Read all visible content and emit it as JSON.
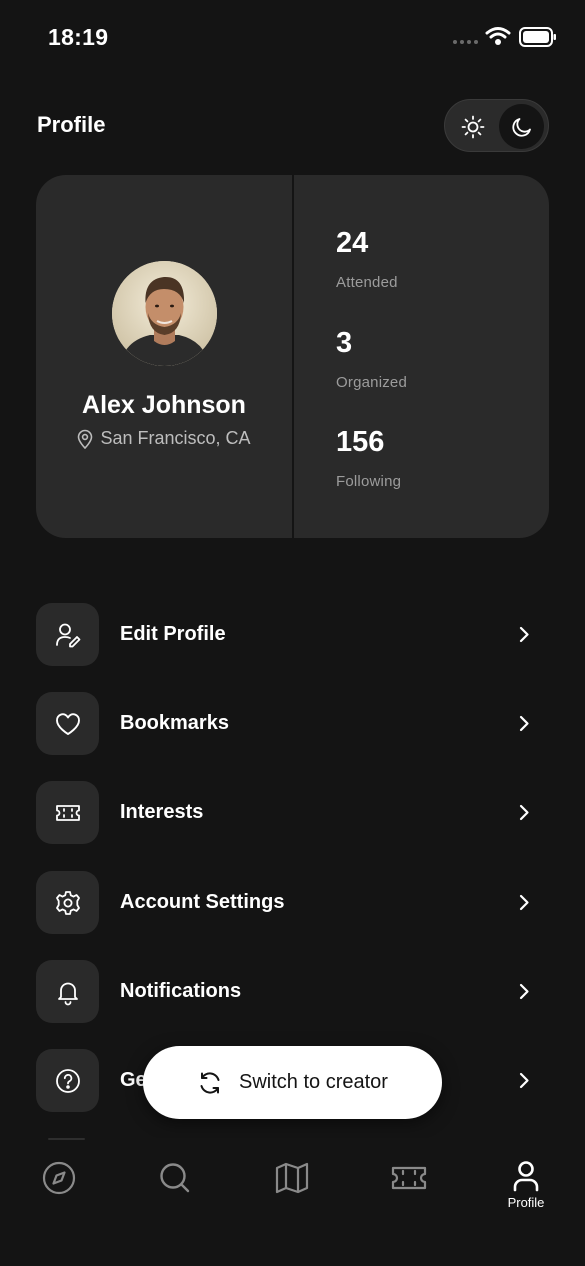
{
  "status_bar": {
    "time": "18:19"
  },
  "header": {
    "title": "Profile"
  },
  "theme_toggle": {
    "light_icon": "sun-icon",
    "dark_icon": "moon-icon",
    "selected": "dark"
  },
  "profile": {
    "name": "Alex Johnson",
    "location": "San Francisco, CA",
    "stats": [
      {
        "value": "24",
        "label": "Attended"
      },
      {
        "value": "3",
        "label": "Organized"
      },
      {
        "value": "156",
        "label": "Following"
      }
    ]
  },
  "menu": {
    "items": [
      {
        "label": "Edit Profile",
        "icon": "user-edit-icon"
      },
      {
        "label": "Bookmarks",
        "icon": "heart-icon"
      },
      {
        "label": "Interests",
        "icon": "ticket-icon"
      },
      {
        "label": "Account Settings",
        "icon": "gear-icon"
      },
      {
        "label": "Notifications",
        "icon": "bell-icon"
      },
      {
        "label": "Ge",
        "icon": "help-icon"
      }
    ]
  },
  "switch_button": {
    "label": "Switch to creator",
    "icon": "refresh-icon"
  },
  "tab_bar": {
    "tabs": [
      {
        "icon": "compass-icon",
        "label": ""
      },
      {
        "icon": "search-icon",
        "label": ""
      },
      {
        "icon": "map-icon",
        "label": ""
      },
      {
        "icon": "ticket-icon",
        "label": ""
      },
      {
        "icon": "user-icon",
        "label": "Profile",
        "active": true
      }
    ]
  },
  "colors": {
    "background": "#141414",
    "card": "#2a2a2a",
    "muted_text": "#9c9c9c",
    "accent_button": "#ffffff"
  }
}
